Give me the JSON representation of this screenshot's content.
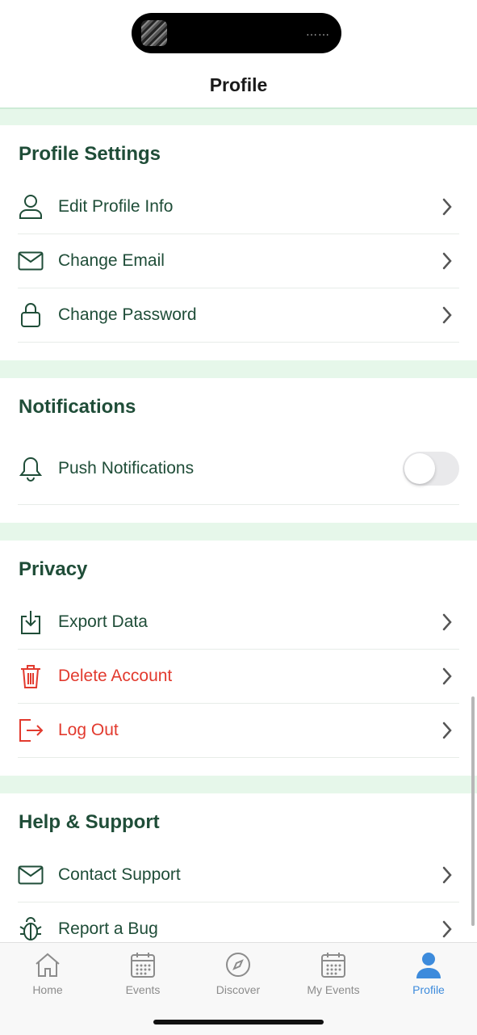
{
  "header": {
    "title": "Profile",
    "status_dots": "……"
  },
  "sections": {
    "profile_settings": {
      "title": "Profile Settings",
      "items": [
        {
          "label": "Edit Profile Info",
          "icon": "person-icon"
        },
        {
          "label": "Change Email",
          "icon": "envelope-icon"
        },
        {
          "label": "Change Password",
          "icon": "lock-icon"
        }
      ]
    },
    "notifications": {
      "title": "Notifications",
      "items": [
        {
          "label": "Push Notifications",
          "icon": "bell-icon",
          "toggle_on": false
        }
      ]
    },
    "privacy": {
      "title": "Privacy",
      "items": [
        {
          "label": "Export Data",
          "icon": "download-icon"
        },
        {
          "label": "Delete Account",
          "icon": "trash-icon",
          "danger": true
        },
        {
          "label": "Log Out",
          "icon": "logout-icon",
          "danger": true
        }
      ]
    },
    "help_support": {
      "title": "Help & Support",
      "items": [
        {
          "label": "Contact Support",
          "icon": "envelope-icon"
        },
        {
          "label": "Report a Bug",
          "icon": "bug-icon"
        }
      ]
    }
  },
  "tabbar": {
    "items": [
      {
        "label": "Home",
        "icon": "home-icon"
      },
      {
        "label": "Events",
        "icon": "calendar-icon"
      },
      {
        "label": "Discover",
        "icon": "compass-icon"
      },
      {
        "label": "My Events",
        "icon": "calendar-icon"
      },
      {
        "label": "Profile",
        "icon": "profile-icon",
        "active": true
      }
    ]
  },
  "colors": {
    "primary_text": "#1f4d38",
    "danger": "#e23a2e",
    "section_gap": "#e6f7ea",
    "tab_active": "#3d8bdc",
    "tab_inactive": "#8c8c8c"
  }
}
